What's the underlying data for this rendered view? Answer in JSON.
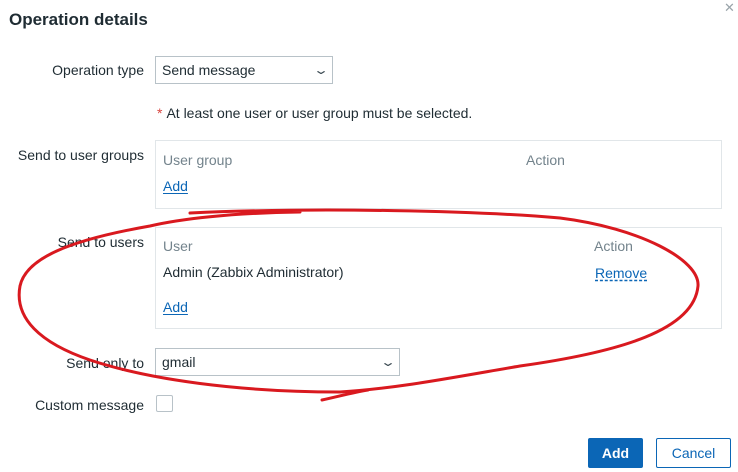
{
  "dialog": {
    "title": "Operation details"
  },
  "form": {
    "operation_type": {
      "label": "Operation type",
      "value": "Send message"
    },
    "required_note": {
      "star": "*",
      "text": "At least one user or user group must be selected."
    },
    "user_groups": {
      "label": "Send to user groups",
      "col_name": "User group",
      "col_action": "Action",
      "add_label": "Add"
    },
    "users": {
      "label": "Send to users",
      "col_name": "User",
      "col_action": "Action",
      "rows": [
        {
          "name": "Admin (Zabbix Administrator)",
          "action": "Remove"
        }
      ],
      "add_label": "Add"
    },
    "send_only_to": {
      "label": "Send only to",
      "value": "gmail"
    },
    "custom_message": {
      "label": "Custom message"
    }
  },
  "footer": {
    "add_label": "Add",
    "cancel_label": "Cancel"
  },
  "icons": {
    "close": "close-icon",
    "dropdown": "chevron-down-icon"
  },
  "colors": {
    "primary": "#0b66b6",
    "annotation": "#d9191f",
    "required": "#d8443f"
  }
}
